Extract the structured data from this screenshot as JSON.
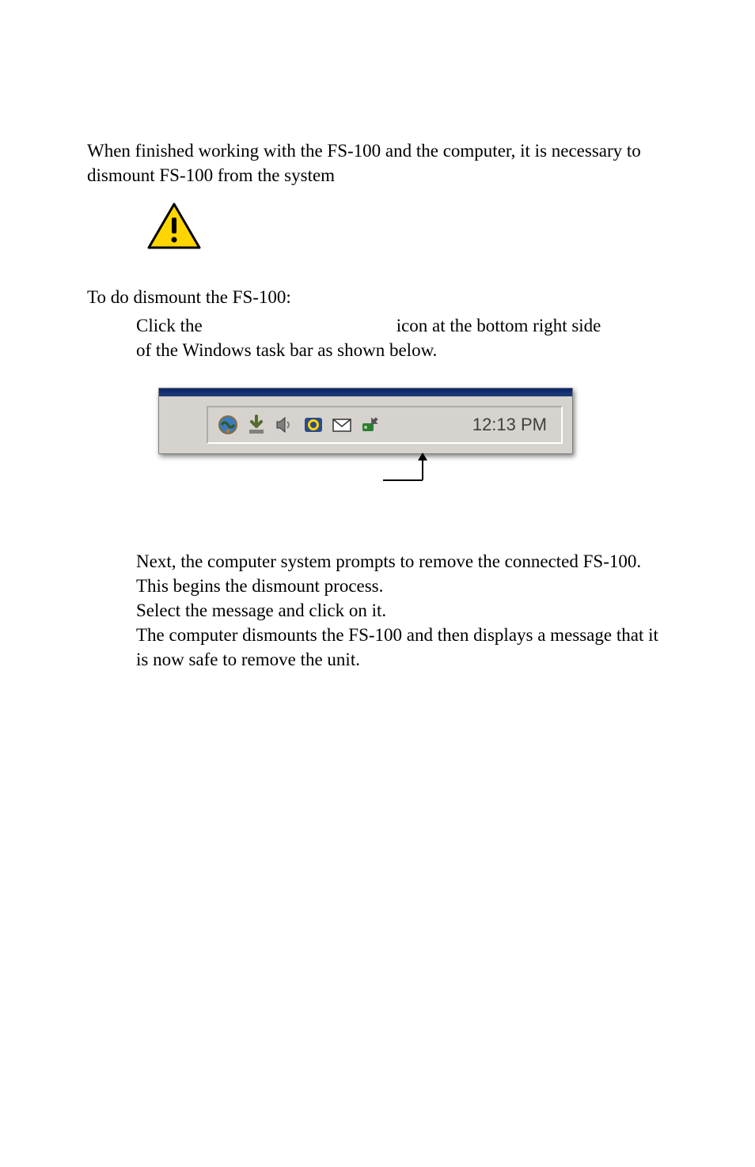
{
  "intro": "When finished working with the FS-100 and the computer, it is necessary to dismount FS-100 from the system",
  "step_heading": "To do dismount the FS-100:",
  "step1": {
    "part1": "Click the",
    "part2": "icon at the bottom right side",
    "part3": "of the Windows task bar as shown below."
  },
  "taskbar": {
    "clock": "12:13 PM",
    "icons": [
      "globe-update-icon",
      "download-icon",
      "speaker-icon",
      "norton-icon",
      "mail-icon",
      "safely-remove-hardware-icon"
    ]
  },
  "step2": "Next, the computer system prompts to remove the connected FS-100. This begins the dismount process.",
  "step3": "Select the message and click on it.",
  "step4": "The computer dismounts the FS-100 and then displays a message that it is now safe to remove the unit."
}
